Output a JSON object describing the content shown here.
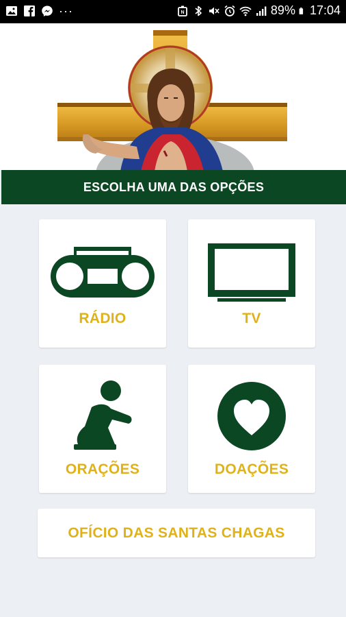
{
  "status_bar": {
    "battery_pct": "89%",
    "time": "17:04",
    "more": "···",
    "icons": [
      "gallery-icon",
      "facebook-icon",
      "messenger-icon",
      "more-icon",
      "nfc-icon",
      "bluetooth-icon",
      "mute-icon",
      "alarm-icon",
      "wifi-icon",
      "signal-icon",
      "battery-icon"
    ]
  },
  "banner": {
    "title": "ESCOLHA UMA DAS OPÇÕES"
  },
  "menu": {
    "radio": {
      "label": "RÁDIO",
      "icon": "radio-icon"
    },
    "tv": {
      "label": "TV",
      "icon": "tv-icon"
    },
    "oracoes": {
      "label": "ORAÇÕES",
      "icon": "praying-person-icon"
    },
    "doacoes": {
      "label": "DOAÇÕES",
      "icon": "heart-icon"
    },
    "oficio": {
      "label": "OFÍCIO DAS SANTAS CHAGAS"
    }
  },
  "colors": {
    "brand_green": "#0b4723",
    "accent_gold": "#e0b21a",
    "background": "#eceff3"
  }
}
